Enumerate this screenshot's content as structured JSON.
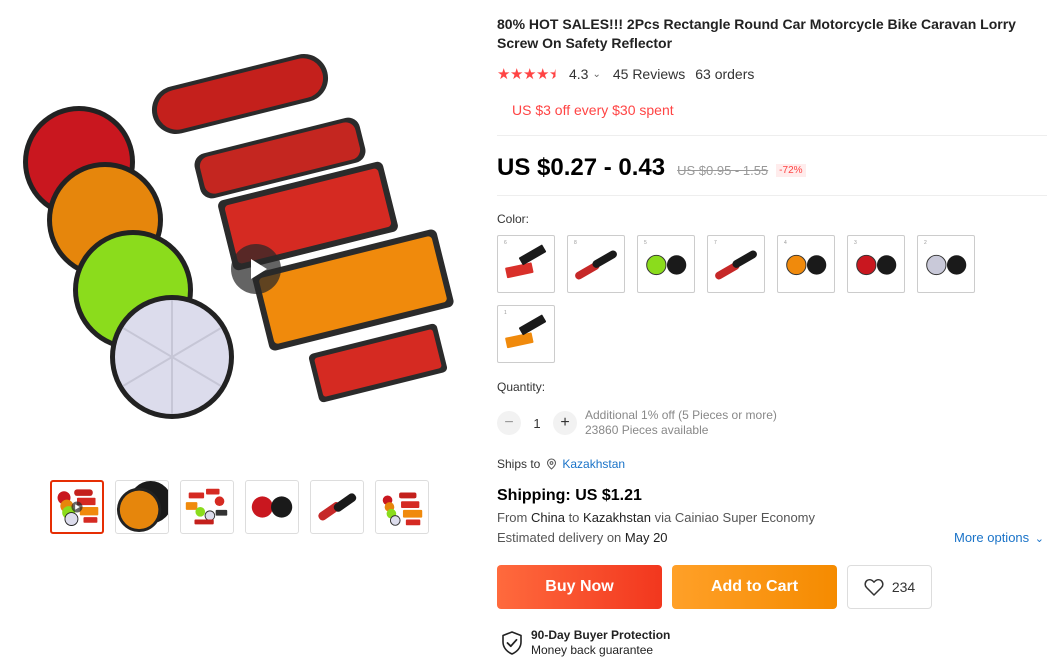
{
  "product": {
    "title": "80% HOT SALES!!! 2Pcs Rectangle Round Car Motorcycle Bike Caravan Lorry Screw On Safety Reflector",
    "rating": "4.3",
    "reviews": "45 Reviews",
    "orders": "63 orders",
    "coupon": "US $3 off every $30 spent",
    "price": "US $0.27 - 0.43",
    "old_price": "US $0.95 - 1.55",
    "discount": "-72%"
  },
  "variants": {
    "label": "Color:",
    "options": [
      {
        "num": "6",
        "name": "red-rectangle-and-black-base",
        "accent": "#d9302a"
      },
      {
        "num": "8",
        "name": "red-oval-and-black-base",
        "accent": "#c62828"
      },
      {
        "num": "5",
        "name": "green-round-and-black-base",
        "accent": "#8bdc1c"
      },
      {
        "num": "7",
        "name": "red-oblong-and-black-base",
        "accent": "#c62828"
      },
      {
        "num": "4",
        "name": "orange-round-and-black-base",
        "accent": "#f08a0c"
      },
      {
        "num": "3",
        "name": "red-round-and-black-base",
        "accent": "#c9171f"
      },
      {
        "num": "2",
        "name": "white-round-and-black-base",
        "accent": "#c9c9d9"
      },
      {
        "num": "1",
        "name": "orange-rectangle-and-black-base",
        "accent": "#f08a0c"
      }
    ]
  },
  "quantity": {
    "label": "Quantity:",
    "value": "1",
    "minus": "−",
    "plus": "+",
    "discount_note": "Additional 1% off (5 Pieces or more)",
    "available": "23860 Pieces available"
  },
  "shipping": {
    "ships_to_label": "Ships to",
    "country": "Kazakhstan",
    "title": "Shipping: US $1.21",
    "from_prefix": "From",
    "from": "China",
    "to_prefix": "to",
    "to": "Kazakhstan",
    "via": "via Cainiao Super Economy",
    "est_prefix": "Estimated delivery on",
    "est_date": "May 20",
    "more_options": "More options"
  },
  "actions": {
    "buy_now": "Buy Now",
    "add_to_cart": "Add to Cart",
    "wishlist_count": "234"
  },
  "protection": {
    "title": "90-Day Buyer Protection",
    "subtitle": "Money back guarantee"
  },
  "thumbnails": [
    {
      "name": "thumb-all-reflectors"
    },
    {
      "name": "thumb-orange-round"
    },
    {
      "name": "thumb-assorted"
    },
    {
      "name": "thumb-red-round"
    },
    {
      "name": "thumb-red-oblong"
    },
    {
      "name": "thumb-group"
    }
  ],
  "colors": {
    "accent": "#f44444",
    "link": "#1a73c8",
    "buy_now": "#f2371e",
    "add_to_cart": "#f58b00"
  }
}
